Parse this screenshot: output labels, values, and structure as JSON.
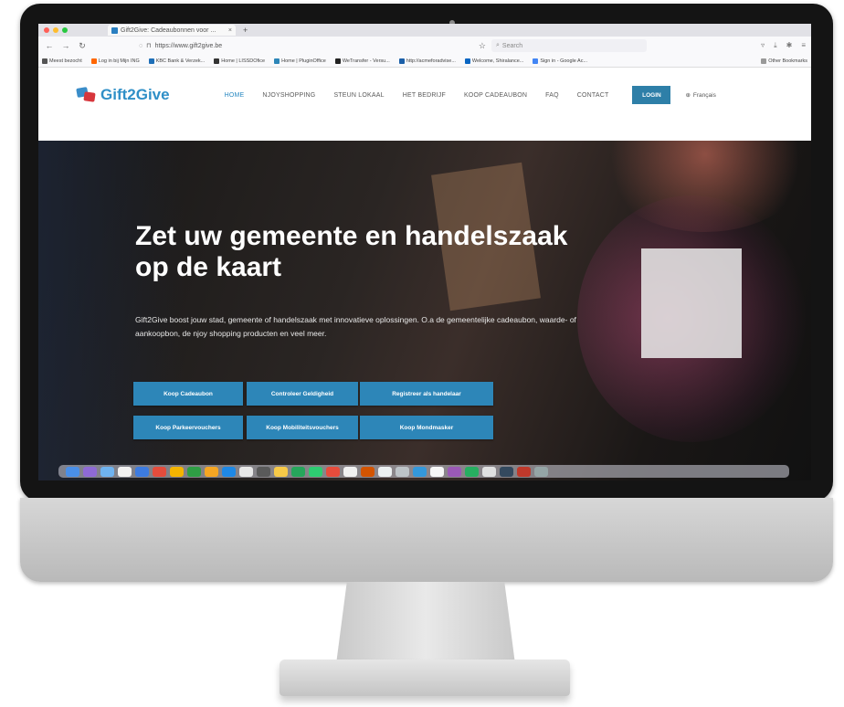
{
  "browser": {
    "tab_title": "Gift2Give: Cadeaubonnen voor ...",
    "tab_close": "×",
    "new_tab": "+",
    "url": "https://www.gift2give.be",
    "search_placeholder": "Search",
    "bookmarks": [
      "Meest bezocht",
      "Log in bij Mijn ING",
      "KBC Bank & Verzek...",
      "Home | LISSDOfice",
      "Home | PluginOffice",
      "WeTransfer - Versu...",
      "http://acmeforadvise...",
      "Welcome, Shiralance...",
      "Sign in - Google Ac..."
    ],
    "other_bookmarks": "Other Bookmarks"
  },
  "site": {
    "logo_text": "Gift2Give",
    "menu": [
      "HOME",
      "NJOYSHOPPING",
      "STEUN LOKAAL",
      "HET BEDRIJF",
      "KOOP CADEAUBON",
      "FAQ",
      "CONTACT"
    ],
    "login_label": "LOGIN",
    "language_label": "Français"
  },
  "hero": {
    "title_line1": "Zet uw gemeente en handelszaak",
    "title_line2": "op de kaart",
    "text": "Gift2Give boost jouw stad, gemeente of handelszaak met innovatieve oplossingen. O.a de gemeentelijke cadeaubon, waarde- of aankoopbon, de njoy shopping producten en veel meer.",
    "buttons": {
      "koop_cadeaubon": "Koop Cadeaubon",
      "controleer_geldigheid": "Controleer Geldigheid",
      "registreer": "Registreer als handelaar",
      "parkeervouchers": "Koop Parkeervouchers",
      "mobiliteitsvouchers": "Koop Mobiliteitsvouchers",
      "mondmasker": "Koop Mondmasker"
    }
  },
  "colors": {
    "accent": "#2d86b8",
    "logo_blue": "#2f8fc7",
    "logo_red": "#d7363c"
  }
}
